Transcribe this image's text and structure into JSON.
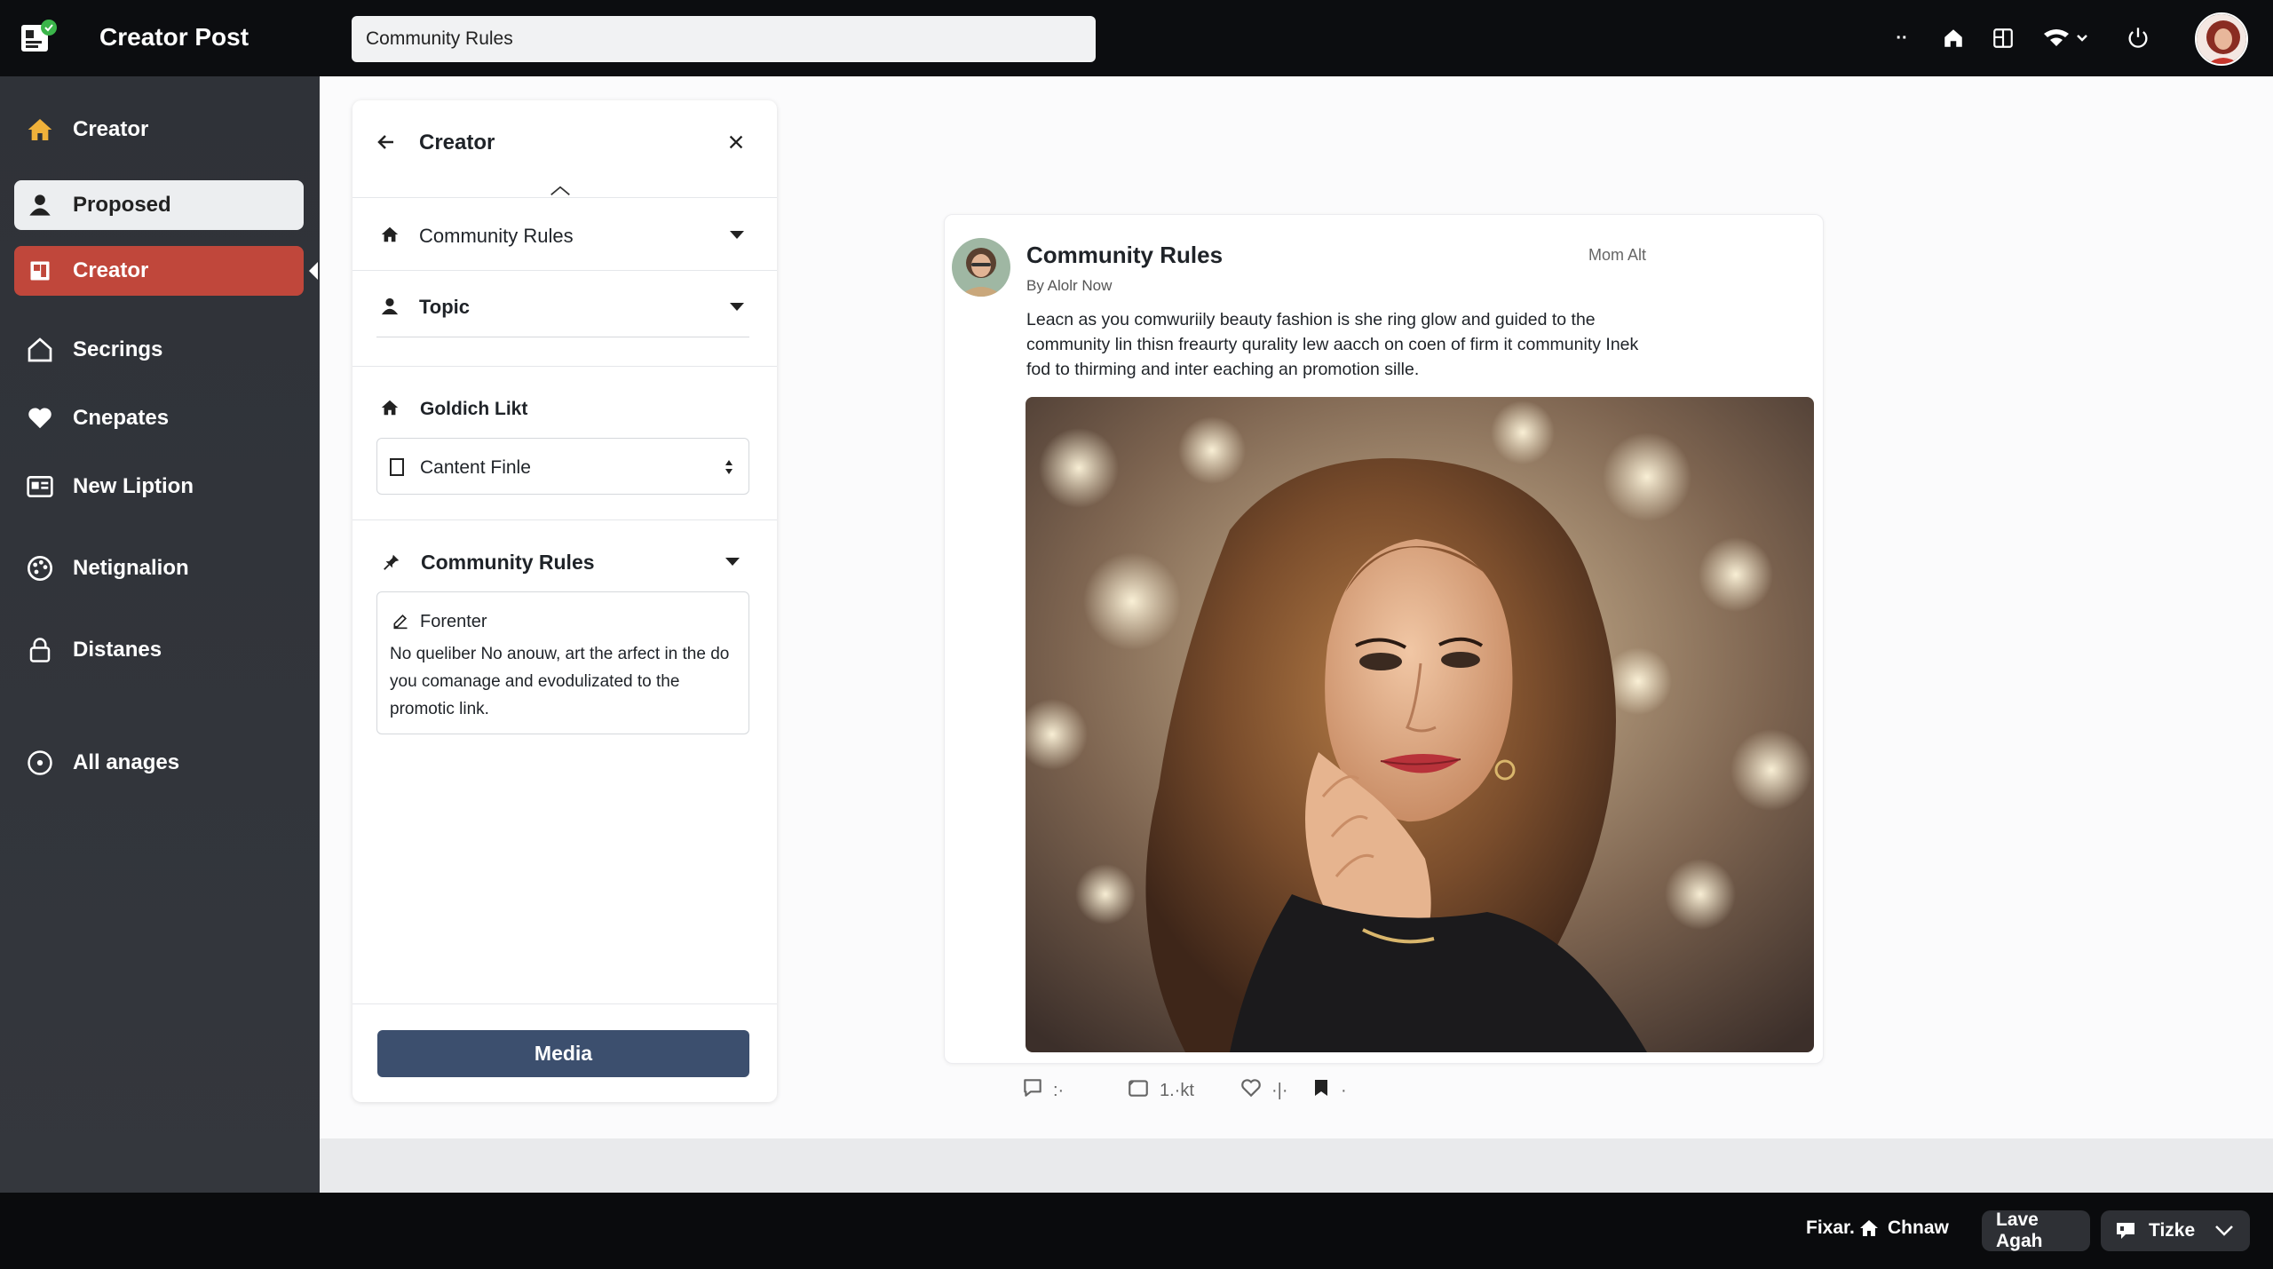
{
  "app": {
    "title": "Creator Post"
  },
  "search": {
    "value": "Community Rules"
  },
  "topbar": {
    "more_label": "··"
  },
  "sidebar": {
    "items": [
      {
        "label": "Creator"
      },
      {
        "label": "Proposed"
      },
      {
        "label": "Creator"
      },
      {
        "label": "Secrings"
      },
      {
        "label": "Cnepates"
      },
      {
        "label": "New Liption"
      },
      {
        "label": "Netignalion"
      },
      {
        "label": "Distanes"
      },
      {
        "label": "All anages"
      }
    ]
  },
  "panel": {
    "title": "Creator",
    "community_rules_row": "Community Rules",
    "topic_row": "Topic",
    "link_label": "Goldich Likt",
    "select_value": "Cantent Finle",
    "rules_section_title": "Community Rules",
    "rules_card_heading": "Forenter",
    "rules_card_text": "No queliber No anouw, art the arfect in the do you comanage and evodulizated to the promotic link.",
    "media_button": "Media"
  },
  "post": {
    "title": "Community Rules",
    "byline": "By Alolr Now",
    "badge": "Mom Alt",
    "body": "Leacn as you comwuriily beauty fashion is she ring glow and guided to the community lin thisn freaurty qurality lew aacch on coen of firm it community Inek fod to thirming and inter eaching an promotion sille.",
    "actions": {
      "comments": ":·",
      "shares": "1.·kt",
      "likes": "·|·",
      "saves": "·"
    }
  },
  "taskbar": {
    "left_text": "Fixar.",
    "home_text": "Chnaw",
    "pill_1": "Lave Agah",
    "pill_2": "Tizke"
  },
  "colors": {
    "topbar": "#0c0d10",
    "sidebar": "#2f3238",
    "active_nav": "#c0473b",
    "media_button": "#3c4f6e",
    "accent_home": "#f0b13a"
  }
}
